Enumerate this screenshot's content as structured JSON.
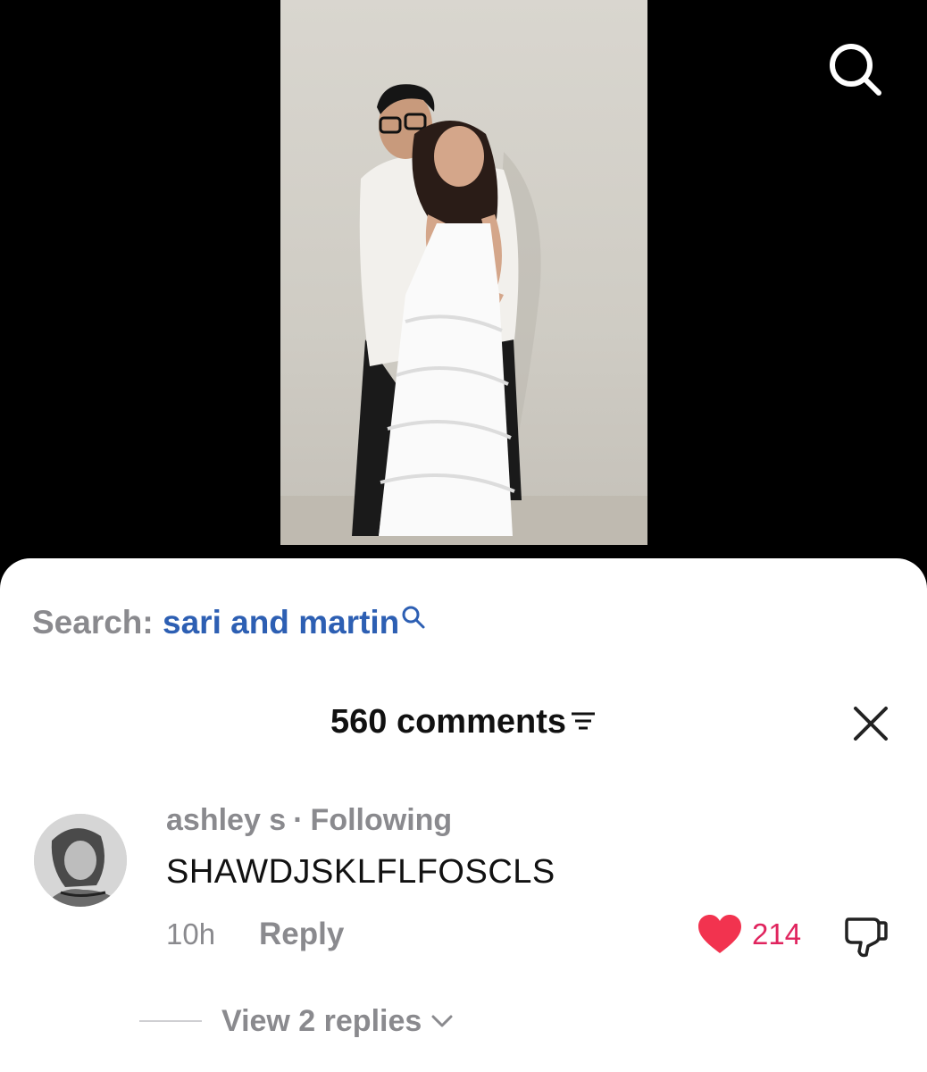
{
  "video": {
    "description_icon": "video-thumbnail"
  },
  "top_bar": {
    "search_icon": "search-icon"
  },
  "search": {
    "prefix": "Search:",
    "term": "sari and martin"
  },
  "comments_panel": {
    "count_label": "560 comments",
    "sort_icon": "sort-filter-icon",
    "close_icon": "close-icon"
  },
  "comment": {
    "author": "ashley s",
    "separator": "·",
    "relation": "Following",
    "text": "SHAWDJSKLFLFOSCLS",
    "time": "10h",
    "reply_label": "Reply",
    "like_count": "214",
    "liked": true,
    "view_replies_label": "View 2 replies"
  },
  "colors": {
    "accent_link": "#2d5fb3",
    "like_red": "#e0245e",
    "muted_text": "#8a8a8e"
  }
}
